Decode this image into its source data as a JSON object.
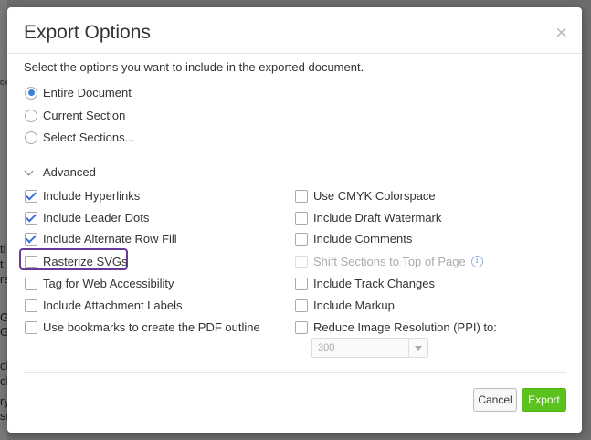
{
  "background": {
    "fragments": [
      "ck",
      "ti",
      "t",
      "ra",
      "Gr",
      "Gr",
      "ch",
      "ch",
      "ry",
      "sic"
    ]
  },
  "dialog": {
    "title": "Export Options",
    "close_glyph": "×",
    "intro": "Select the options you want to include in the exported document.",
    "scope_options": [
      {
        "label": "Entire Document",
        "selected": true
      },
      {
        "label": "Current Section",
        "selected": false
      },
      {
        "label": "Select Sections...",
        "selected": false
      }
    ],
    "advanced_label": "Advanced",
    "left_options": [
      {
        "label": "Include Hyperlinks",
        "checked": true
      },
      {
        "label": "Include Leader Dots",
        "checked": true
      },
      {
        "label": "Include Alternate Row Fill",
        "checked": true
      },
      {
        "label": "Rasterize SVGs",
        "checked": false
      },
      {
        "label": "Tag for Web Accessibility",
        "checked": false
      },
      {
        "label": "Include Attachment Labels",
        "checked": false
      },
      {
        "label": "Use bookmarks to create the PDF outline",
        "checked": false
      }
    ],
    "right_options": [
      {
        "label": "Use CMYK Colorspace",
        "checked": false
      },
      {
        "label": "Include Draft Watermark",
        "checked": false
      },
      {
        "label": "Include Comments",
        "checked": false
      },
      {
        "label": "Shift Sections to Top of Page",
        "checked": false,
        "disabled": true,
        "info_glyph": "i"
      },
      {
        "label": "Include Track Changes",
        "checked": false
      },
      {
        "label": "Include Markup",
        "checked": false
      },
      {
        "label": "Reduce Image Resolution (PPI) to:",
        "checked": false
      }
    ],
    "ppi_select": {
      "value": "300"
    },
    "buttons": {
      "cancel": "Cancel",
      "export": "Export"
    },
    "colors": {
      "export_button": "#5cc21d",
      "highlight_border": "#6a3a9b",
      "checkmark": "#3b6fd1"
    }
  }
}
